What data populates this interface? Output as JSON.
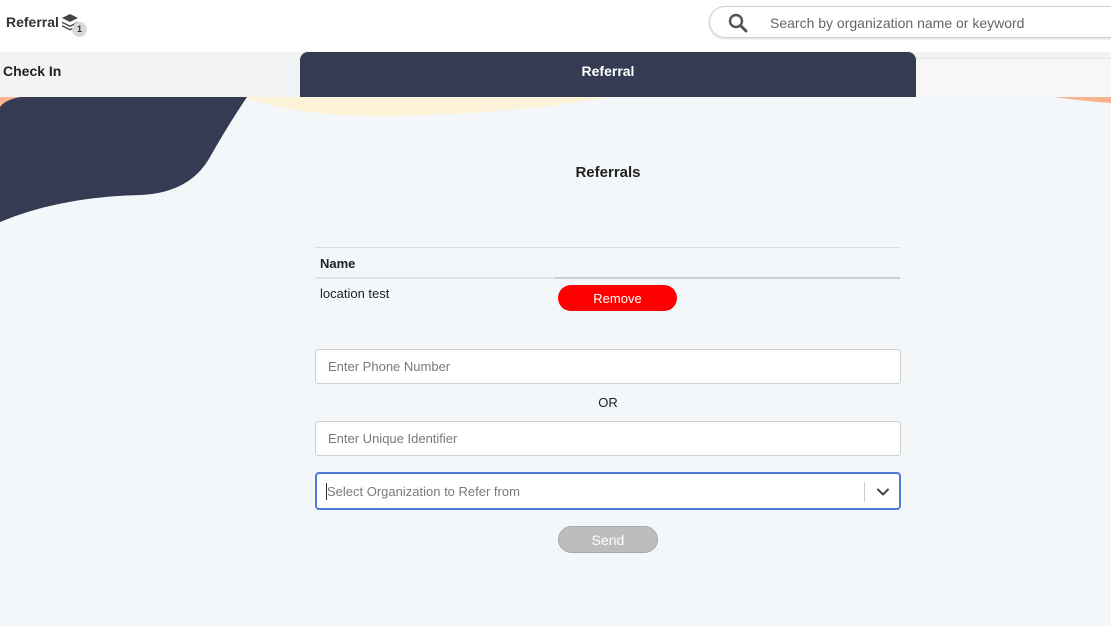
{
  "header": {
    "brand_label": "Referral",
    "badge_count": "1",
    "search_placeholder": "Search by organization name or keyword"
  },
  "tabs": {
    "checkin_label": "Check In",
    "referral_label": "Referral"
  },
  "main": {
    "title": "Referrals",
    "table": {
      "column_name": "Name",
      "rows": [
        {
          "name": "location test",
          "action_label": "Remove"
        }
      ]
    },
    "phone_placeholder": "Enter Phone Number",
    "or_label": "OR",
    "uid_placeholder": "Enter Unique Identifier",
    "org_select_placeholder": "Select Organization to Refer from",
    "send_label": "Send"
  },
  "colors": {
    "tab_active_bg": "#343b52",
    "remove_button": "#ff0000",
    "select_focus_border": "#4c7bd8",
    "send_disabled": "#bdbdbd",
    "page_bg": "#f3f7fa",
    "accent_peach": "#f9b48f",
    "accent_cream": "#fcf3d9"
  },
  "icons": {
    "brand": "layers-icon",
    "search": "search-icon",
    "dropdown": "chevron-down-icon"
  }
}
